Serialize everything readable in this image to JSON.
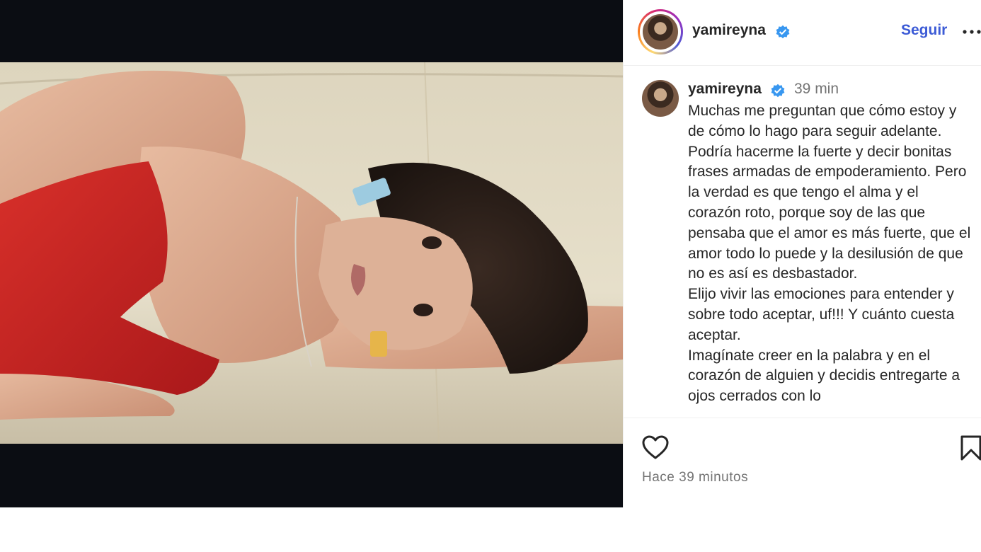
{
  "post": {
    "username": "yamireyna",
    "verified_icon": "verified-badge-icon",
    "follow_label": "Seguir",
    "more_icon": "more-options-icon",
    "time_ago": "39 min",
    "caption": "Muchas me preguntan que cómo estoy y de cómo lo hago para seguir adelante. Podría hacerme la fuerte y decir bonitas frases armadas de empoderamiento. Pero la verdad es que tengo el alma y el corazón roto, porque soy de las que pensaba que el amor es más fuerte, que el amor todo lo puede y la desilusión de que no es así es desbastador.\nElijo vivir las emociones para entender y sobre todo aceptar, uf!!! Y cuánto cuesta aceptar.\nImagínate creer en la palabra y en el corazón de alguien y decidis entregarte a ojos cerrados con lo",
    "like_icon": "heart-icon",
    "save_icon": "bookmark-icon",
    "posted_label": "Hace 39 minutos"
  },
  "colors": {
    "accent": "#3c5bd6",
    "verified": "#3897f0",
    "text": "#262626",
    "muted": "#737373",
    "media_bg": "#0b0d13",
    "dress": "#c8231f"
  }
}
